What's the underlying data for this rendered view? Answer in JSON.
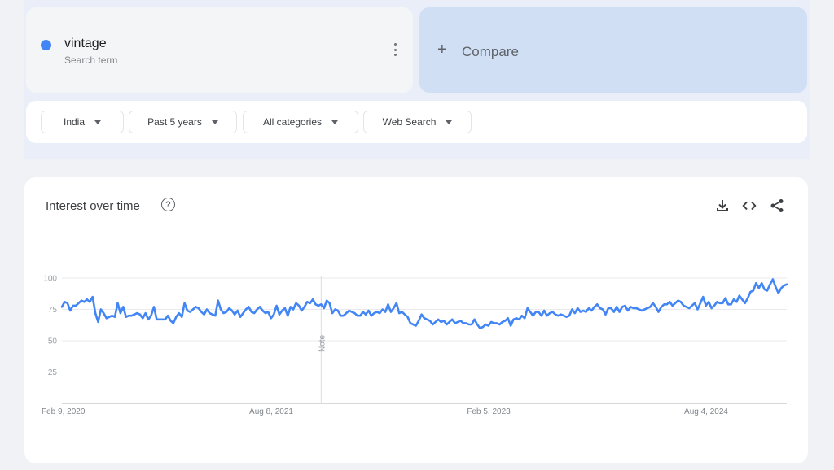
{
  "search_term": {
    "name": "vintage",
    "subtitle": "Search term",
    "color": "#4285f4"
  },
  "compare": {
    "icon": "plus-icon",
    "label": "Compare"
  },
  "filters": [
    {
      "label": "India"
    },
    {
      "label": "Past 5 years"
    },
    {
      "label": "All categories"
    },
    {
      "label": "Web Search"
    }
  ],
  "chart_card": {
    "title": "Interest over time",
    "help_icon": "?",
    "tools": [
      "download-icon",
      "embed-code-icon",
      "share-icon"
    ]
  },
  "chart_data": {
    "type": "line",
    "title": "Interest over time",
    "xlabel": "",
    "ylabel": "",
    "ylim": [
      0,
      100
    ],
    "yticks": [
      25,
      50,
      75,
      100
    ],
    "xtick_labels": [
      "Feb 9, 2020",
      "Aug 8, 2021",
      "Feb 5, 2023",
      "Aug 4, 2024"
    ],
    "xtick_positions_week_index": [
      0,
      78,
      156,
      234
    ],
    "grid": true,
    "legend": "none",
    "annotation": {
      "label": "Note",
      "week_index": 93
    },
    "series": [
      {
        "name": "vintage",
        "color": "#4285f4",
        "values": [
          77,
          81,
          80,
          74,
          78,
          78,
          80,
          82,
          81,
          83,
          81,
          85,
          72,
          65,
          75,
          72,
          68,
          69,
          70,
          69,
          80,
          72,
          77,
          69,
          70,
          70,
          71,
          72,
          71,
          68,
          72,
          67,
          70,
          77,
          67,
          67,
          67,
          67,
          70,
          66,
          64,
          69,
          72,
          69,
          80,
          74,
          73,
          75,
          77,
          76,
          73,
          71,
          75,
          72,
          71,
          70,
          82,
          75,
          72,
          73,
          76,
          74,
          71,
          74,
          69,
          72,
          75,
          77,
          73,
          72,
          75,
          77,
          74,
          72,
          73,
          68,
          71,
          78,
          71,
          74,
          76,
          70,
          77,
          75,
          80,
          78,
          74,
          77,
          81,
          80,
          83,
          79,
          78,
          79,
          76,
          82,
          80,
          72,
          75,
          74,
          70,
          70,
          72,
          74,
          73,
          72,
          70,
          70,
          73,
          71,
          74,
          70,
          72,
          73,
          72,
          75,
          73,
          79,
          73,
          76,
          80,
          72,
          73,
          71,
          69,
          64,
          63,
          62,
          66,
          71,
          68,
          67,
          66,
          63,
          65,
          67,
          65,
          66,
          63,
          65,
          67,
          64,
          65,
          66,
          64,
          64,
          63,
          63,
          67,
          63,
          60,
          61,
          63,
          62,
          65,
          64,
          64,
          63,
          65,
          66,
          68,
          62,
          67,
          68,
          67,
          70,
          68,
          76,
          73,
          70,
          73,
          73,
          70,
          74,
          70,
          72,
          73,
          71,
          70,
          71,
          70,
          69,
          70,
          75,
          72,
          76,
          73,
          74,
          73,
          76,
          74,
          77,
          79,
          76,
          75,
          71,
          76,
          76,
          73,
          77,
          73,
          77,
          78,
          74,
          77,
          76,
          76,
          75,
          74,
          75,
          76,
          77,
          80,
          77,
          73,
          77,
          79,
          79,
          81,
          78,
          80,
          82,
          81,
          78,
          77,
          76,
          78,
          80,
          75,
          80,
          85,
          78,
          81,
          76,
          78,
          81,
          80,
          80,
          84,
          79,
          79,
          83,
          81,
          86,
          83,
          80,
          84,
          89,
          90,
          96,
          92,
          96,
          91,
          90,
          95,
          99,
          93,
          88,
          92,
          94,
          95
        ]
      }
    ]
  }
}
